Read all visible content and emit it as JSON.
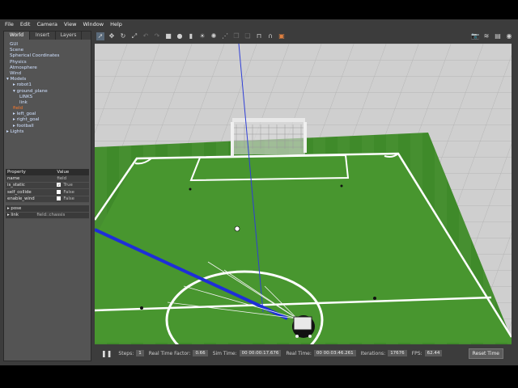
{
  "menu": [
    "File",
    "Edit",
    "Camera",
    "View",
    "Window",
    "Help"
  ],
  "tabs": [
    "World",
    "Insert",
    "Layers"
  ],
  "tree": [
    {
      "label": "GUI",
      "indent": 1
    },
    {
      "label": "Scene",
      "indent": 1
    },
    {
      "label": "Spherical Coordinates",
      "indent": 1
    },
    {
      "label": "Physics",
      "indent": 1
    },
    {
      "label": "Atmosphere",
      "indent": 1
    },
    {
      "label": "Wind",
      "indent": 1
    },
    {
      "label": "▾ Models",
      "indent": 0
    },
    {
      "label": "▸ robot1",
      "indent": 2
    },
    {
      "label": "▾ ground_plane",
      "indent": 2
    },
    {
      "label": "LINKS",
      "indent": 4
    },
    {
      "label": "link",
      "indent": 4
    },
    {
      "label": "field",
      "indent": 2,
      "highlight": true
    },
    {
      "label": "▸ left_goal",
      "indent": 2
    },
    {
      "label": "▸ right_goal",
      "indent": 2
    },
    {
      "label": "▸ football",
      "indent": 2
    },
    {
      "label": "▸ Lights",
      "indent": 0
    }
  ],
  "properties": {
    "headers": [
      "Property",
      "Value"
    ],
    "rows": [
      {
        "name": "name",
        "value": "field",
        "check": ""
      },
      {
        "name": "is_static",
        "value": "True",
        "check": "✓"
      },
      {
        "name": "self_collide",
        "value": "False",
        "check": " "
      },
      {
        "name": "enable_wind",
        "value": "False",
        "check": " "
      }
    ],
    "extra": [
      {
        "name": "▸ pose",
        "value": ""
      },
      {
        "name": "▸ link",
        "value": "field::chassis"
      }
    ]
  },
  "toolbar_icons": [
    "select-arrow",
    "translate",
    "rotate",
    "scale",
    "undo",
    "redo",
    "box",
    "sphere",
    "cylinder",
    "sun",
    "point-light",
    "spot-light",
    "copy",
    "paste",
    "align",
    "snap",
    "view-angle"
  ],
  "bottom": {
    "steps_label": "Steps:",
    "steps_value": "1",
    "rtf_label": "Real Time Factor:",
    "rtf_value": "0.66",
    "sim_label": "Sim Time:",
    "sim_value": "00 00:00:17.676",
    "real_label": "Real Time:",
    "real_value": "00 00:03:46.261",
    "iter_label": "Iterations:",
    "iter_value": "17676",
    "fps_label": "FPS:",
    "fps_value": "62.44",
    "reset_label": "Reset Time"
  },
  "colors": {
    "grass": "#3f8a2a",
    "sky": "#c8c8c8",
    "highlight": "#ff7a2a"
  }
}
